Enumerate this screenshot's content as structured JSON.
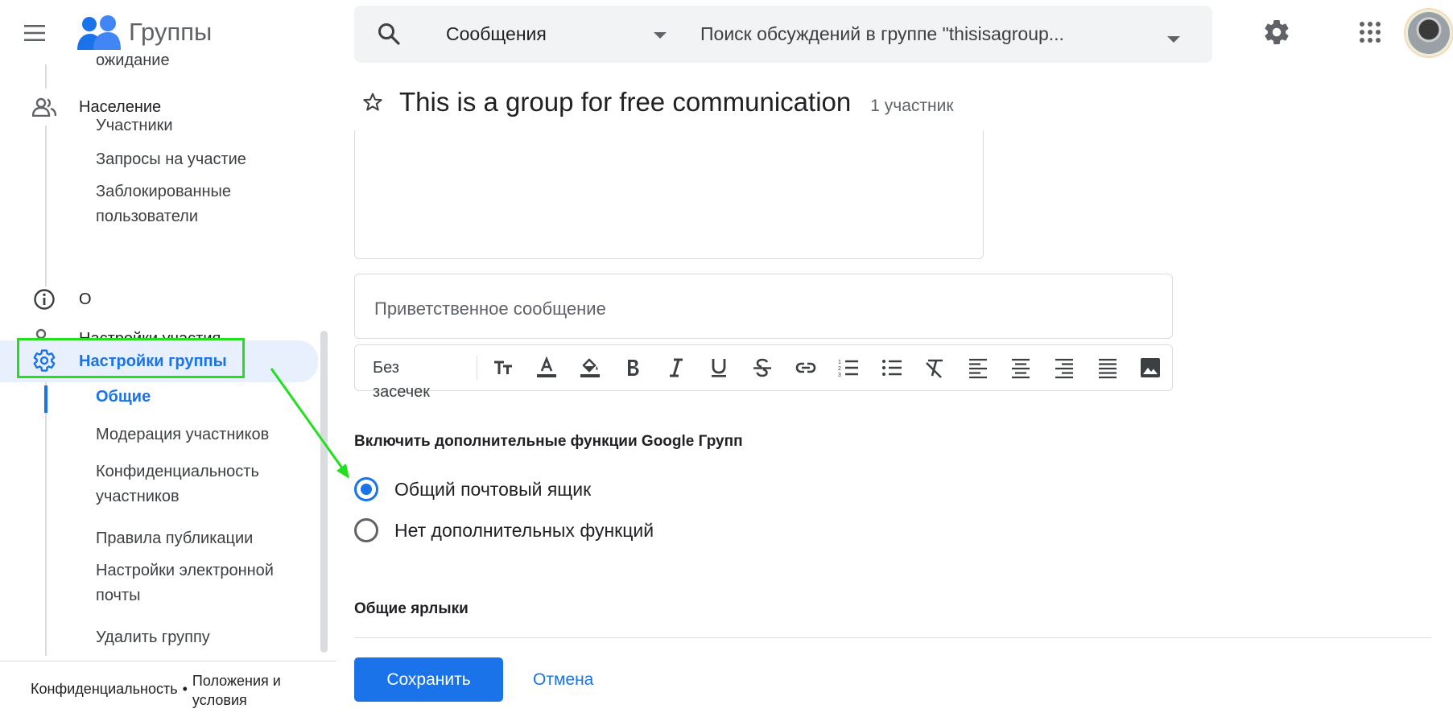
{
  "app": {
    "name": "Группы"
  },
  "search": {
    "scope": "Сообщения",
    "placeholder": "Поиск обсуждений в группе \"thisisagroup..."
  },
  "sidebar": {
    "partial_top_label": "ожидание",
    "sections": [
      {
        "label": "Население",
        "icon": "people-icon"
      },
      {
        "label": "О",
        "icon": "info-icon"
      },
      {
        "label": "Настройки участия",
        "icon": "person-settings-icon"
      },
      {
        "label": "Настройки группы",
        "icon": "gear-icon",
        "active": true
      }
    ],
    "population_items": [
      "Участники",
      "Запросы на участие",
      "Заблокированные\nпользователи"
    ],
    "group_settings_items": [
      "Общие",
      "Модерация участников",
      "Конфиденциальность\nучастников",
      "Правила публикации",
      "Настройки электронной\nпочты",
      "Удалить группу"
    ],
    "active_sub_item": "Общие"
  },
  "footer": {
    "privacy": "Конфиденциальность",
    "separator": "•",
    "terms": "Положения и\nусловия"
  },
  "main": {
    "group_title": "This is a group for free communication",
    "member_count": "1 участник",
    "welcome_placeholder": "Приветственное сообщение",
    "toolbar": {
      "font": "Без засечек",
      "buttons": [
        "text-size-icon",
        "text-color-icon",
        "highlight-color-icon",
        "bold-icon",
        "italic-icon",
        "underline-icon",
        "strikethrough-icon",
        "link-icon",
        "numbered-list-icon",
        "bulleted-list-icon",
        "clear-format-icon",
        "align-left-icon",
        "align-center-icon",
        "align-right-icon",
        "justify-icon",
        "image-icon"
      ]
    },
    "features_title": "Включить дополнительные функции Google Групп",
    "feature_options": [
      {
        "label": "Общий почтовый ящик",
        "checked": true
      },
      {
        "label": "Нет дополнительных функций",
        "checked": false
      }
    ],
    "labels_title": "Общие ярлыки",
    "save_label": "Сохранить",
    "cancel_label": "Отмена"
  },
  "colors": {
    "accent": "#1a73e8",
    "annotation": "#22e020"
  }
}
